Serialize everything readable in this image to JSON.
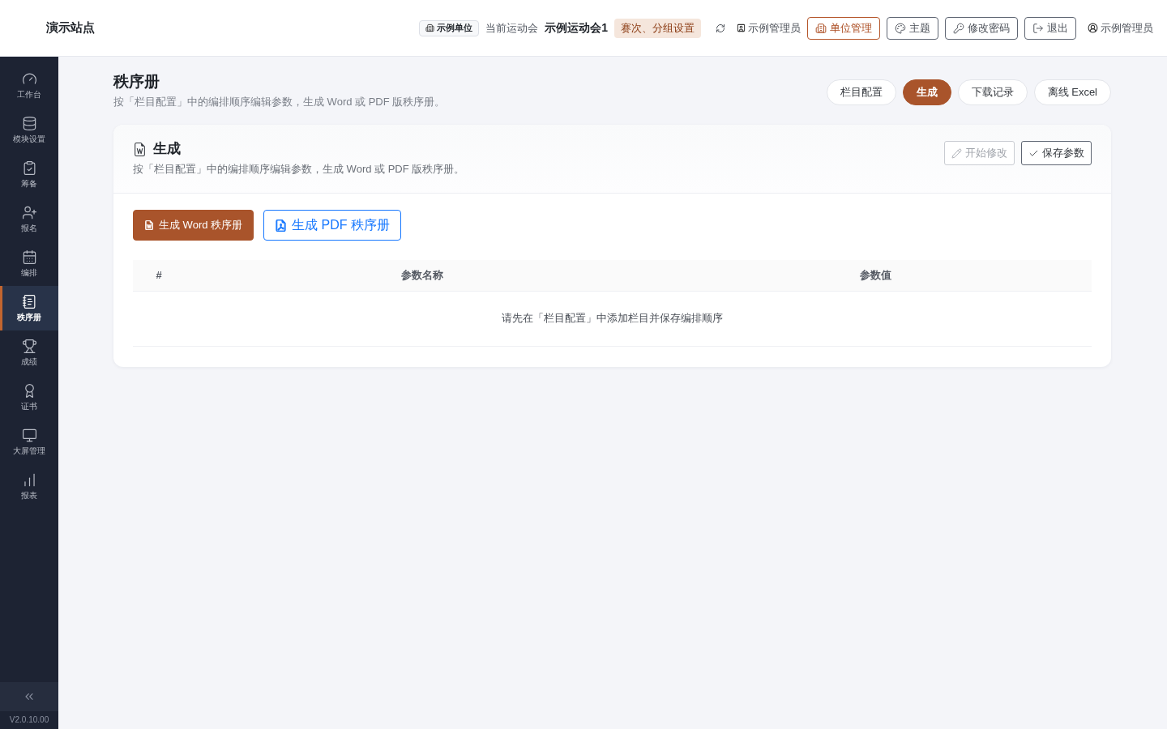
{
  "header": {
    "site_name": "演示站点",
    "unit_badge": "示例单位",
    "meet_label": "当前运动会",
    "meet_name": "示例运动会1",
    "meet_settings_tag": "赛次、分组设置",
    "role": "示例管理员",
    "buttons": [
      {
        "label": "单位管理",
        "kind": "accent"
      },
      {
        "label": "主题",
        "kind": "outline"
      },
      {
        "label": "修改密码",
        "kind": "outline"
      },
      {
        "label": "退出",
        "kind": "outline"
      }
    ],
    "user": "示例管理员"
  },
  "sidebar": {
    "items": [
      {
        "label": "工作台",
        "selected": false
      },
      {
        "label": "模块设置",
        "selected": false
      },
      {
        "label": "筹备",
        "selected": false
      },
      {
        "label": "报名",
        "selected": false
      },
      {
        "label": "编排",
        "selected": false
      },
      {
        "label": "秩序册",
        "selected": true
      },
      {
        "label": "成绩",
        "selected": false
      },
      {
        "label": "证书",
        "selected": false
      },
      {
        "label": "大屏管理",
        "selected": false
      },
      {
        "label": "报表",
        "selected": false
      }
    ],
    "version": "V2.0.10.00"
  },
  "page": {
    "title": "秩序册",
    "subtitle": "按「栏目配置」中的编排顺序编辑参数，生成 Word 或 PDF 版秩序册。",
    "tabs": [
      {
        "label": "栏目配置",
        "selected": false
      },
      {
        "label": "生成",
        "selected": true
      },
      {
        "label": "下载记录",
        "selected": false
      },
      {
        "label": "离线 Excel",
        "selected": false
      }
    ]
  },
  "card": {
    "title": "生成",
    "subtitle": "按「栏目配置」中的编排顺序编辑参数，生成 Word 或 PDF 版秩序册。",
    "actions": [
      {
        "label": "开始修改",
        "disabled": true
      },
      {
        "label": "保存参数",
        "disabled": false
      }
    ],
    "generate_buttons": [
      {
        "label": "生成 Word 秩序册",
        "kind": "word"
      },
      {
        "label": "生成 PDF 秩序册",
        "kind": "pdf"
      }
    ],
    "table": {
      "columns": [
        "#",
        "参数名称",
        "参数值"
      ],
      "empty_text": "请先在「栏目配置」中添加栏目并保存编排顺序"
    }
  }
}
